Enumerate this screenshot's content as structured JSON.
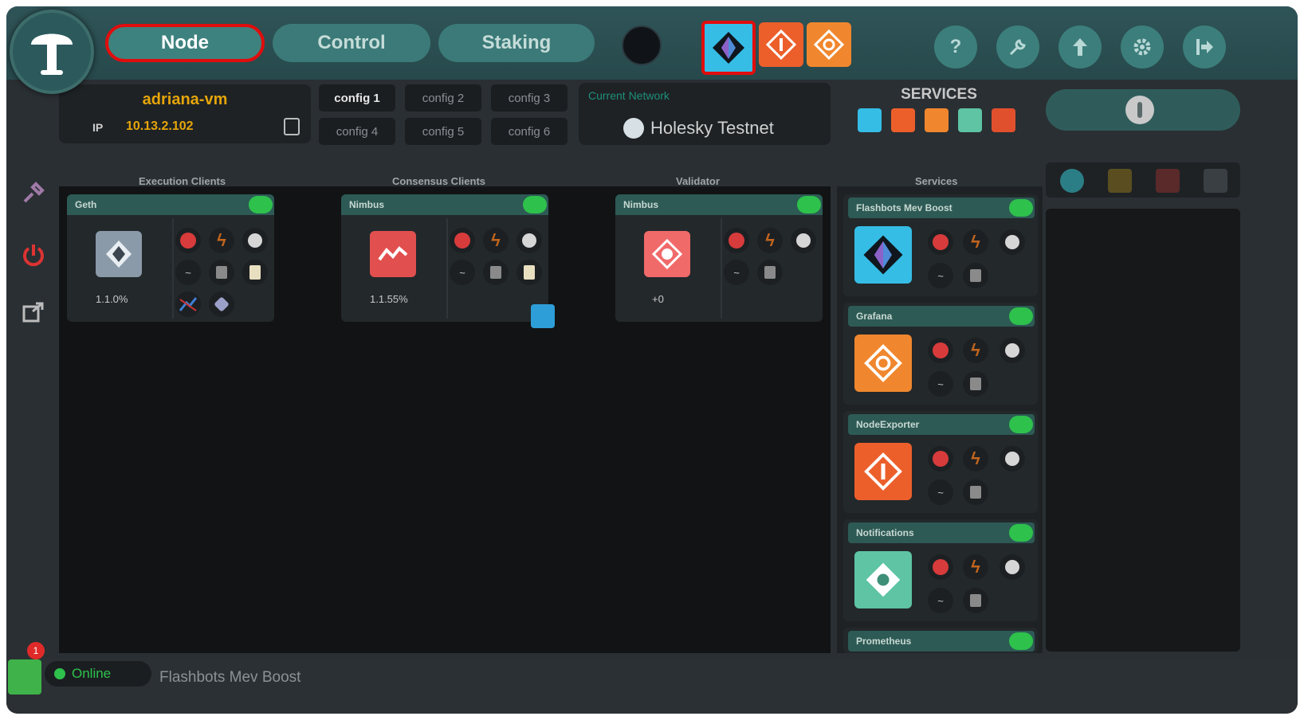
{
  "header": {
    "tabs": [
      {
        "label": "Node",
        "active": true
      },
      {
        "label": "Control",
        "active": false
      },
      {
        "label": "Staking",
        "active": false
      }
    ],
    "top_services": [
      {
        "name": "flashbots-icon",
        "color": "#35bde6",
        "highlighted": true
      },
      {
        "name": "node-exporter-icon",
        "color": "#ec5f2b"
      },
      {
        "name": "grafana-icon",
        "color": "#f0872e"
      }
    ],
    "right_icons": [
      "help-icon",
      "wrench-icon",
      "upload-icon",
      "gear-icon",
      "logout-icon"
    ],
    "help_glyph": "?"
  },
  "server": {
    "name": "adriana-vm",
    "ip_label": "IP",
    "ip": "10.13.2.102"
  },
  "configs": [
    "config 1",
    "config 2",
    "config 3",
    "config 4",
    "config 5",
    "config 6"
  ],
  "network": {
    "label": "Current Network",
    "name": "Holesky Testnet"
  },
  "services_header": "SERVICES",
  "columns": {
    "execution": "Execution Clients",
    "consensus": "Consensus Clients",
    "validator": "Validator",
    "services": "Services"
  },
  "clients": [
    {
      "name": "Geth",
      "stat": "1.1.0%",
      "logo_color": "#8a9aa8"
    },
    {
      "name": "Nimbus",
      "stat": "1.1.55%",
      "logo_color": "#e24f4f"
    },
    {
      "name": "Nimbus",
      "stat": "+0",
      "logo_color": "#f06a6a"
    }
  ],
  "services": [
    {
      "name": "Flashbots Mev Boost",
      "color": "#35bde6"
    },
    {
      "name": "Grafana",
      "color": "#f0872e"
    },
    {
      "name": "NodeExporter",
      "color": "#ec5f2b"
    },
    {
      "name": "Notifications",
      "color": "#5ec4a3"
    },
    {
      "name": "Prometheus",
      "color": "#e0502d"
    }
  ],
  "footer": {
    "status": "Online",
    "badge_count": "1",
    "current_service": "Flashbots Mev Boost"
  },
  "colors": {
    "accent": "#3b7a78",
    "highlight": "#e00d0d",
    "toggle_on": "#2ec14c",
    "server_name": "#e6a50a"
  }
}
